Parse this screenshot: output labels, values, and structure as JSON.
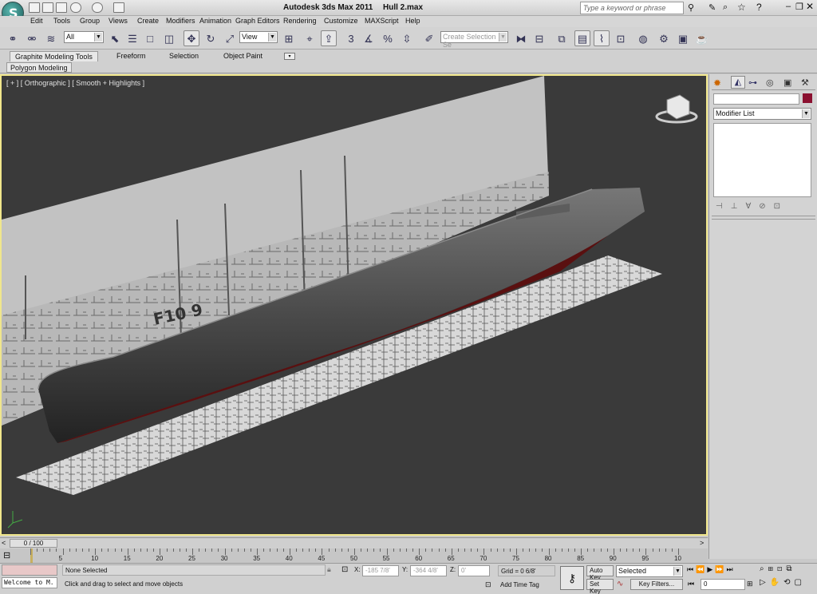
{
  "window": {
    "app_title": "Autodesk 3ds Max  2011",
    "file_title": "Hull 2.max",
    "search_placeholder": "Type a keyword or phrase"
  },
  "menu": [
    "Edit",
    "Tools",
    "Group",
    "Views",
    "Create",
    "Modifiers",
    "Animation",
    "Graph Editors",
    "Rendering",
    "Customize",
    "MAXScript",
    "Help"
  ],
  "toolbar": {
    "selection_filter": "All",
    "reference_coord": "View",
    "named_selection_placeholder": "Create Selection Se"
  },
  "ribbon": {
    "tabs": [
      "Graphite Modeling Tools",
      "Freeform",
      "Selection",
      "Object Paint"
    ],
    "subtab": "Polygon Modeling"
  },
  "viewport": {
    "label": "[ + ] [ Orthographic ] [ Smooth + Highlights ]",
    "hull_marking": "F10 9"
  },
  "command_panel": {
    "modifier_list": "Modifier List",
    "color_swatch": "#8b1030"
  },
  "time_slider": {
    "frame": "0 / 100",
    "frame_max": 100,
    "current": 0
  },
  "track_ticks": [
    "5",
    "10",
    "15",
    "20",
    "25",
    "30",
    "35",
    "40",
    "45",
    "50",
    "55",
    "60",
    "65",
    "70",
    "75",
    "80",
    "85",
    "90",
    "95",
    "10"
  ],
  "status": {
    "maxscript_listener": "Welcome to M.",
    "selection": "None Selected",
    "prompt": "Click and drag to select and move objects",
    "x_label": "X:",
    "x_value": "-185 7/8'",
    "y_label": "Y:",
    "y_value": "-364 4/8'",
    "z_label": "Z:",
    "z_value": "0'",
    "grid": "Grid = 0 6/8'",
    "add_time_tag": "Add Time Tag",
    "auto_key": "Auto Key",
    "set_key": "Set Key",
    "key_mode": "Selected",
    "key_filters": "Key Filters...",
    "frame_field": "0"
  }
}
